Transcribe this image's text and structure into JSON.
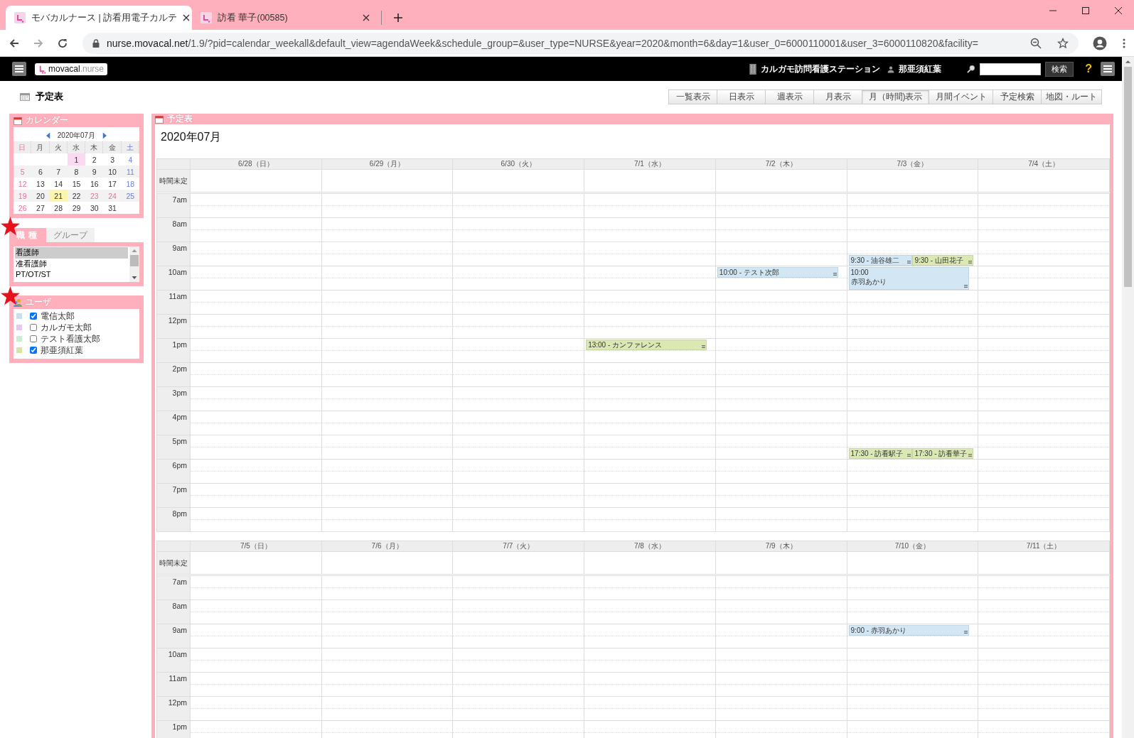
{
  "browser": {
    "tabs": [
      {
        "title": "モバカルナース | 訪看用電子カルテ",
        "selected": true
      },
      {
        "title": "訪看 華子(00585)",
        "selected": false
      }
    ],
    "url_host": "nurse.movacal.net",
    "url_path": "/1.9/?pid=calendar_weekall&default_view=agendaWeek&schedule_group=&user_type=NURSE&year=2020&month=6&day=1&user_0=6000110001&user_3=6000110820&facility="
  },
  "header": {
    "logo_main": "movacal",
    "logo_sub": ".nurse",
    "facility": "カルガモ訪問看護ステーション",
    "user": "那亜須紅葉",
    "search_button": "検索",
    "help": "?"
  },
  "page_title": "予定表",
  "views": [
    {
      "label": "一覧表示",
      "selected": false
    },
    {
      "label": "日表示",
      "selected": false
    },
    {
      "label": "週表示",
      "selected": false
    },
    {
      "label": "月表示",
      "selected": false
    },
    {
      "label": "月（時間)表示",
      "selected": true
    },
    {
      "label": "月間イベント",
      "selected": false
    },
    {
      "label": "予定検索",
      "selected": false
    },
    {
      "label": "地図・ルート",
      "selected": false
    }
  ],
  "sidebar": {
    "calendar": {
      "title": "カレンダー",
      "month": "2020年07月",
      "weekdays": [
        {
          "label": "日",
          "kind": "sun"
        },
        {
          "label": "月",
          "kind": "weekday"
        },
        {
          "label": "火",
          "kind": "weekday"
        },
        {
          "label": "水",
          "kind": "weekday"
        },
        {
          "label": "木",
          "kind": "weekday"
        },
        {
          "label": "金",
          "kind": "weekday"
        },
        {
          "label": "土",
          "kind": "sat"
        }
      ],
      "weeks": [
        [
          {
            "day": "1",
            "kind": "weekday",
            "selected": true,
            "today": false
          },
          {
            "day": "2",
            "kind": "weekday",
            "selected": false,
            "today": false
          },
          {
            "day": "3",
            "kind": "weekday",
            "selected": false,
            "today": false
          },
          {
            "day": "4",
            "kind": "sat",
            "selected": false,
            "today": false
          }
        ],
        [
          {
            "day": "5",
            "kind": "sun",
            "selected": false,
            "today": false
          },
          {
            "day": "6",
            "kind": "weekday",
            "selected": false,
            "today": false
          },
          {
            "day": "7",
            "kind": "weekday",
            "selected": false,
            "today": false
          },
          {
            "day": "8",
            "kind": "weekday",
            "selected": false,
            "today": false
          },
          {
            "day": "9",
            "kind": "weekday",
            "selected": false,
            "today": false
          },
          {
            "day": "10",
            "kind": "weekday",
            "selected": false,
            "today": false
          },
          {
            "day": "11",
            "kind": "sat",
            "selected": false,
            "today": false
          }
        ],
        [
          {
            "day": "12",
            "kind": "sun",
            "selected": false,
            "today": false
          },
          {
            "day": "13",
            "kind": "weekday",
            "selected": false,
            "today": false
          },
          {
            "day": "14",
            "kind": "weekday",
            "selected": false,
            "today": false
          },
          {
            "day": "15",
            "kind": "weekday",
            "selected": false,
            "today": false
          },
          {
            "day": "16",
            "kind": "weekday",
            "selected": false,
            "today": false
          },
          {
            "day": "17",
            "kind": "weekday",
            "selected": false,
            "today": false
          },
          {
            "day": "18",
            "kind": "sat",
            "selected": false,
            "today": false
          }
        ],
        [
          {
            "day": "19",
            "kind": "sun",
            "selected": false,
            "today": false
          },
          {
            "day": "20",
            "kind": "weekday",
            "selected": false,
            "today": false
          },
          {
            "day": "21",
            "kind": "weekday",
            "selected": false,
            "today": true
          },
          {
            "day": "22",
            "kind": "weekday",
            "selected": false,
            "today": false
          },
          {
            "day": "23",
            "kind": "holiday",
            "selected": false,
            "today": false
          },
          {
            "day": "24",
            "kind": "holiday",
            "selected": false,
            "today": false
          },
          {
            "day": "25",
            "kind": "sat",
            "selected": false,
            "today": false
          }
        ],
        [
          {
            "day": "26",
            "kind": "sun",
            "selected": false,
            "today": false
          },
          {
            "day": "27",
            "kind": "weekday",
            "selected": false,
            "today": false
          },
          {
            "day": "28",
            "kind": "weekday",
            "selected": false,
            "today": false
          },
          {
            "day": "29",
            "kind": "weekday",
            "selected": false,
            "today": false
          },
          {
            "day": "30",
            "kind": "weekday",
            "selected": false,
            "today": false
          },
          {
            "day": "31",
            "kind": "weekday",
            "selected": false,
            "today": false
          }
        ]
      ]
    },
    "tabs": [
      {
        "label": "職種",
        "selected": true
      },
      {
        "label": "グループ",
        "selected": false
      }
    ],
    "job_types": [
      {
        "label": "看護師",
        "selected": true
      },
      {
        "label": "准看護師",
        "selected": false
      },
      {
        "label": "PT/OT/ST",
        "selected": false
      }
    ],
    "users": {
      "title": "ユーザ",
      "items": [
        {
          "name": "電信太郎",
          "color": "#c6e0f2",
          "checked": true
        },
        {
          "name": "カルガモ太郎",
          "color": "#e6c8ee",
          "checked": false
        },
        {
          "name": "テスト看護太郎",
          "color": "#c8efd2",
          "checked": false
        },
        {
          "name": "那亜須紅葉",
          "color": "#d8e4a2",
          "checked": true
        }
      ]
    }
  },
  "schedule": {
    "title": "予定表",
    "month": "2020年07月",
    "weeks": [
      {
        "untimed_label": "時間未定",
        "hours": [
          "7am",
          "8am",
          "9am",
          "10am",
          "11am",
          "12pm",
          "1pm",
          "2pm",
          "3pm",
          "4pm",
          "5pm",
          "6pm",
          "7pm",
          "8pm"
        ],
        "days": [
          {
            "label": "6/28（日）"
          },
          {
            "label": "6/29（月）"
          },
          {
            "label": "6/30（火）"
          },
          {
            "label": "7/1（水）",
            "events": [
              {
                "label": "13:00 - カンファレンス",
                "kind": "full",
                "long": false,
                "color": "#dce8b4"
              }
            ]
          },
          {
            "label": "7/2（木）",
            "events": [
              {
                "label": "10:00 - テスト次郎",
                "kind": "full",
                "long": false,
                "color": "#d3e6f3"
              }
            ]
          },
          {
            "label": "7/3（金）",
            "events": [
              {
                "label": "9:30 - 油谷雄二",
                "kind": "left",
                "long": false,
                "color": "#d3e6f3"
              },
              {
                "label": "9:30 - 山田花子",
                "kind": "right",
                "long": false,
                "color": "#dce8b4"
              },
              {
                "label": "10:00",
                "detail": "赤羽あかり",
                "kind": "full",
                "long": true,
                "color": "#d3e6f3"
              },
              {
                "label": "17:30 - 訪看駅子",
                "kind": "left",
                "long": false,
                "color": "#dce8b4"
              },
              {
                "label": "17:30 - 訪看華子",
                "kind": "right",
                "long": false,
                "color": "#dce8b4"
              }
            ]
          },
          {
            "label": "7/4（土）"
          }
        ]
      },
      {
        "untimed_label": "時間未定",
        "hours": [
          "7am",
          "8am",
          "9am",
          "10am",
          "11am",
          "12pm",
          "1pm"
        ],
        "days": [
          {
            "label": "7/5（日）"
          },
          {
            "label": "7/6（月）"
          },
          {
            "label": "7/7（火）"
          },
          {
            "label": "7/8（水）"
          },
          {
            "label": "7/9（木）"
          },
          {
            "label": "7/10（金）",
            "events": [
              {
                "label": "9:00 - 赤羽あかり",
                "kind": "full",
                "long": false,
                "color": "#d3e6f3"
              }
            ]
          },
          {
            "label": "7/11（土）"
          }
        ]
      }
    ]
  }
}
